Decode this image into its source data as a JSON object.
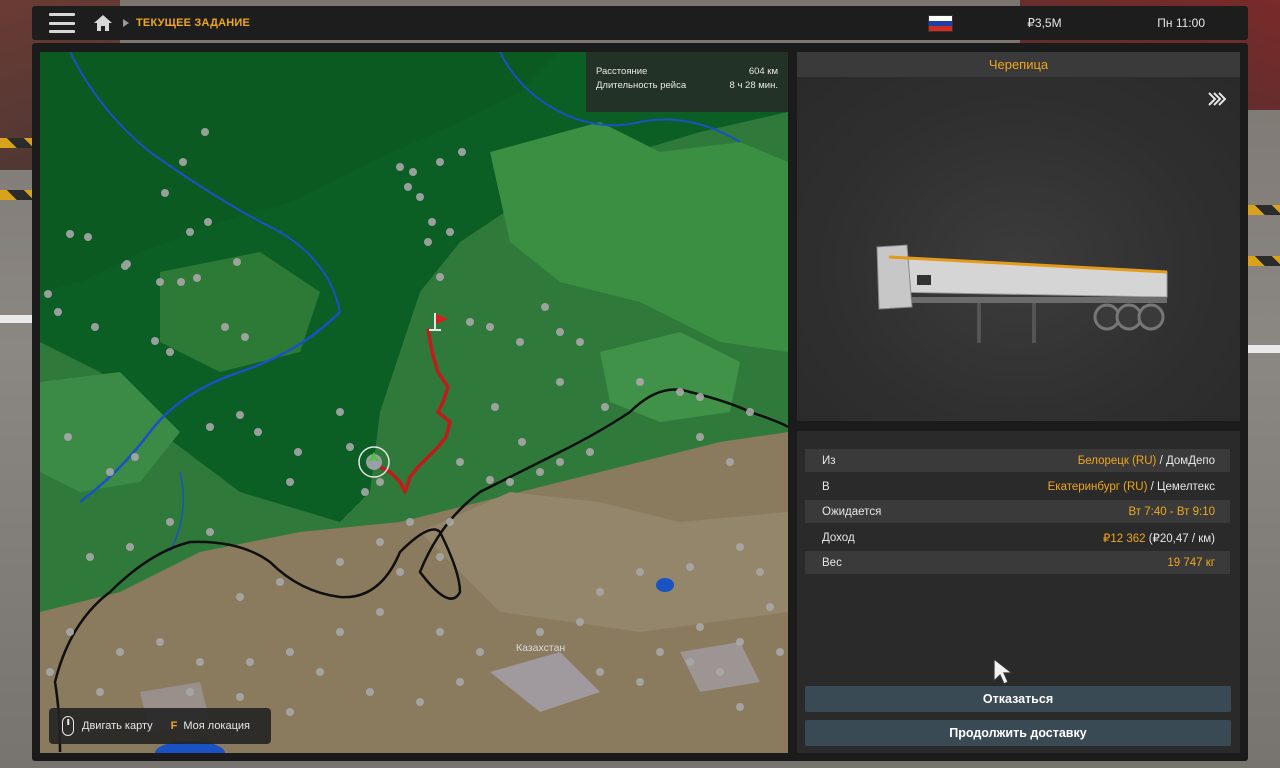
{
  "topbar": {
    "breadcrumb": "ТЕКУЩЕЕ ЗАДАНИЕ",
    "money": "₽3,5M",
    "time": "Пн 11:00"
  },
  "map": {
    "distance_label": "Расстояние",
    "distance_value": "604 км",
    "duration_label": "Длительность рейса",
    "duration_value": "8 ч 28 мин.",
    "country_label": "Казахстан",
    "controls": {
      "move_label": "Двигать карту",
      "location_key": "F",
      "location_label": "Моя локация"
    }
  },
  "cargo": {
    "title": "Черепица"
  },
  "job": {
    "from_label": "Из",
    "from_city": "Белорецк (RU)",
    "from_company": "ДомДепо",
    "to_label": "В",
    "to_city": "Екатеринбург (RU)",
    "to_company": "Цемелтекс",
    "expected_label": "Ожидается",
    "expected_value": "Вт 7:40 - Вт 9:10",
    "income_label": "Доход",
    "income_value": "₽12 362",
    "income_rate": "(₽20,47 / км)",
    "weight_label": "Вес",
    "weight_value": "19 747 кг"
  },
  "buttons": {
    "cancel": "Отказаться",
    "continue": "Продолжить доставку"
  },
  "colors": {
    "accent": "#f0a61d",
    "route": "#c21b1b",
    "button_bg": "#3a4a55"
  }
}
